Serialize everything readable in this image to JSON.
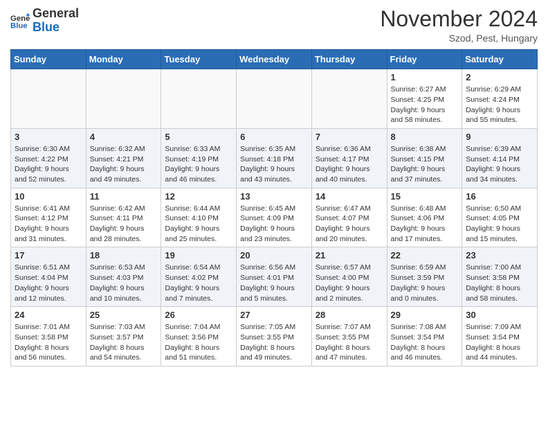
{
  "header": {
    "logo_line1": "General",
    "logo_line2": "Blue",
    "month": "November 2024",
    "location": "Szod, Pest, Hungary"
  },
  "days_of_week": [
    "Sunday",
    "Monday",
    "Tuesday",
    "Wednesday",
    "Thursday",
    "Friday",
    "Saturday"
  ],
  "weeks": [
    [
      {
        "day": "",
        "info": ""
      },
      {
        "day": "",
        "info": ""
      },
      {
        "day": "",
        "info": ""
      },
      {
        "day": "",
        "info": ""
      },
      {
        "day": "",
        "info": ""
      },
      {
        "day": "1",
        "info": "Sunrise: 6:27 AM\nSunset: 4:25 PM\nDaylight: 9 hours\nand 58 minutes."
      },
      {
        "day": "2",
        "info": "Sunrise: 6:29 AM\nSunset: 4:24 PM\nDaylight: 9 hours\nand 55 minutes."
      }
    ],
    [
      {
        "day": "3",
        "info": "Sunrise: 6:30 AM\nSunset: 4:22 PM\nDaylight: 9 hours\nand 52 minutes."
      },
      {
        "day": "4",
        "info": "Sunrise: 6:32 AM\nSunset: 4:21 PM\nDaylight: 9 hours\nand 49 minutes."
      },
      {
        "day": "5",
        "info": "Sunrise: 6:33 AM\nSunset: 4:19 PM\nDaylight: 9 hours\nand 46 minutes."
      },
      {
        "day": "6",
        "info": "Sunrise: 6:35 AM\nSunset: 4:18 PM\nDaylight: 9 hours\nand 43 minutes."
      },
      {
        "day": "7",
        "info": "Sunrise: 6:36 AM\nSunset: 4:17 PM\nDaylight: 9 hours\nand 40 minutes."
      },
      {
        "day": "8",
        "info": "Sunrise: 6:38 AM\nSunset: 4:15 PM\nDaylight: 9 hours\nand 37 minutes."
      },
      {
        "day": "9",
        "info": "Sunrise: 6:39 AM\nSunset: 4:14 PM\nDaylight: 9 hours\nand 34 minutes."
      }
    ],
    [
      {
        "day": "10",
        "info": "Sunrise: 6:41 AM\nSunset: 4:12 PM\nDaylight: 9 hours\nand 31 minutes."
      },
      {
        "day": "11",
        "info": "Sunrise: 6:42 AM\nSunset: 4:11 PM\nDaylight: 9 hours\nand 28 minutes."
      },
      {
        "day": "12",
        "info": "Sunrise: 6:44 AM\nSunset: 4:10 PM\nDaylight: 9 hours\nand 25 minutes."
      },
      {
        "day": "13",
        "info": "Sunrise: 6:45 AM\nSunset: 4:09 PM\nDaylight: 9 hours\nand 23 minutes."
      },
      {
        "day": "14",
        "info": "Sunrise: 6:47 AM\nSunset: 4:07 PM\nDaylight: 9 hours\nand 20 minutes."
      },
      {
        "day": "15",
        "info": "Sunrise: 6:48 AM\nSunset: 4:06 PM\nDaylight: 9 hours\nand 17 minutes."
      },
      {
        "day": "16",
        "info": "Sunrise: 6:50 AM\nSunset: 4:05 PM\nDaylight: 9 hours\nand 15 minutes."
      }
    ],
    [
      {
        "day": "17",
        "info": "Sunrise: 6:51 AM\nSunset: 4:04 PM\nDaylight: 9 hours\nand 12 minutes."
      },
      {
        "day": "18",
        "info": "Sunrise: 6:53 AM\nSunset: 4:03 PM\nDaylight: 9 hours\nand 10 minutes."
      },
      {
        "day": "19",
        "info": "Sunrise: 6:54 AM\nSunset: 4:02 PM\nDaylight: 9 hours\nand 7 minutes."
      },
      {
        "day": "20",
        "info": "Sunrise: 6:56 AM\nSunset: 4:01 PM\nDaylight: 9 hours\nand 5 minutes."
      },
      {
        "day": "21",
        "info": "Sunrise: 6:57 AM\nSunset: 4:00 PM\nDaylight: 9 hours\nand 2 minutes."
      },
      {
        "day": "22",
        "info": "Sunrise: 6:59 AM\nSunset: 3:59 PM\nDaylight: 9 hours\nand 0 minutes."
      },
      {
        "day": "23",
        "info": "Sunrise: 7:00 AM\nSunset: 3:58 PM\nDaylight: 8 hours\nand 58 minutes."
      }
    ],
    [
      {
        "day": "24",
        "info": "Sunrise: 7:01 AM\nSunset: 3:58 PM\nDaylight: 8 hours\nand 56 minutes."
      },
      {
        "day": "25",
        "info": "Sunrise: 7:03 AM\nSunset: 3:57 PM\nDaylight: 8 hours\nand 54 minutes."
      },
      {
        "day": "26",
        "info": "Sunrise: 7:04 AM\nSunset: 3:56 PM\nDaylight: 8 hours\nand 51 minutes."
      },
      {
        "day": "27",
        "info": "Sunrise: 7:05 AM\nSunset: 3:55 PM\nDaylight: 8 hours\nand 49 minutes."
      },
      {
        "day": "28",
        "info": "Sunrise: 7:07 AM\nSunset: 3:55 PM\nDaylight: 8 hours\nand 47 minutes."
      },
      {
        "day": "29",
        "info": "Sunrise: 7:08 AM\nSunset: 3:54 PM\nDaylight: 8 hours\nand 46 minutes."
      },
      {
        "day": "30",
        "info": "Sunrise: 7:09 AM\nSunset: 3:54 PM\nDaylight: 8 hours\nand 44 minutes."
      }
    ]
  ]
}
